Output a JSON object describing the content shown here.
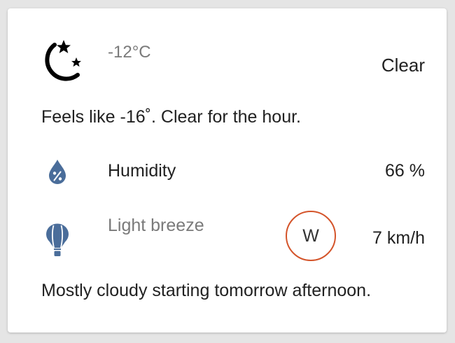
{
  "weather": {
    "condition_icon": "moon-stars-icon",
    "temperature": "-12°C",
    "condition": "Clear",
    "summary": "Feels like -16˚. Clear for the hour.",
    "forecast": "Mostly cloudy starting tomorrow afternoon."
  },
  "humidity": {
    "icon": "humidity-drop-icon",
    "label": "Humidity",
    "value": "66 %"
  },
  "wind": {
    "icon": "hot-air-balloon-icon",
    "label": "Light breeze",
    "direction": "W",
    "speed": "7 km/h"
  },
  "colors": {
    "icon_blue": "#4a6d9a",
    "wind_ring": "#d4542a",
    "muted_text": "#7a7a7a",
    "primary_text": "#212121"
  }
}
